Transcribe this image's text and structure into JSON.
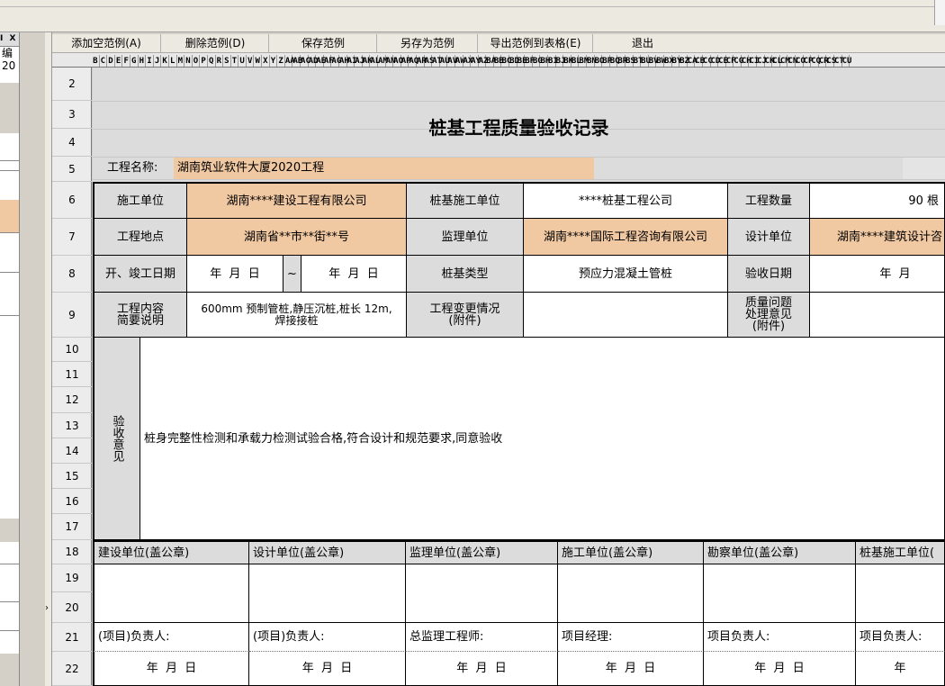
{
  "left_pane": {
    "header": "I X",
    "label": "编\n20"
  },
  "toolbar": {
    "add": "添加空范例(A)",
    "delete": "删除范例(D)",
    "save": "保存范例",
    "save_as": "另存为范例",
    "export": "导出范例到表格(E)",
    "exit": "退出"
  },
  "columns": [
    "B",
    "C",
    "D",
    "E",
    "F",
    "G",
    "H",
    "I",
    "J",
    "K",
    "L",
    "M",
    "N",
    "O",
    "P",
    "Q",
    "R",
    "S",
    "T",
    "U",
    "V",
    "W",
    "X",
    "Y",
    "Z",
    "AA",
    "AB",
    "AC",
    "AD",
    "AE",
    "AF",
    "AG",
    "AH",
    "AI",
    "AJ",
    "AK",
    "AL",
    "AM",
    "AN",
    "AO",
    "AP",
    "AQ",
    "AR",
    "AS",
    "AT",
    "AU",
    "AV",
    "AW",
    "AX",
    "AY",
    "AZ",
    "BA",
    "BB",
    "BC",
    "BD",
    "BE",
    "BF",
    "BG",
    "BH",
    "BI",
    "BJ",
    "BK",
    "BL",
    "BM",
    "BN",
    "BO",
    "BP",
    "BQ",
    "BR",
    "BS",
    "BT",
    "BU",
    "BV",
    "BW",
    "BX",
    "BY",
    "BZ",
    "CA",
    "CB",
    "CC",
    "CD",
    "CE",
    "CF",
    "CG",
    "CH",
    "CI",
    "CJ",
    "CK",
    "CL",
    "CM",
    "CN",
    "CO",
    "CP",
    "CQ",
    "CR",
    "CS",
    "CT",
    "CU"
  ],
  "row_numbers": [
    "2",
    "3",
    "4",
    "5",
    "6",
    "7",
    "8",
    "9",
    "10",
    "11",
    "12",
    "13",
    "14",
    "15",
    "16",
    "17",
    "18",
    "19",
    "20",
    "21",
    "22"
  ],
  "form": {
    "title": "桩基工程质量验收记录",
    "project_name_label": "工程名称:",
    "project_name": "湖南筑业软件大厦2020工程",
    "construction_unit_label": "施工单位",
    "construction_unit": "湖南****建设工程有限公司",
    "pile_unit_label": "桩基施工单位",
    "pile_unit": "****桩基工程公司",
    "quantity_label": "工程数量",
    "quantity": "90 根",
    "location_label": "工程地点",
    "location": "湖南省**市**街**号",
    "supervision_label": "监理单位",
    "supervision": "湖南****国际工程咨询有限公司",
    "design_label": "设计单位",
    "design": "湖南****建筑设计咨",
    "dates_label": "开、竣工日期",
    "start_date": "年  月  日",
    "tilde": "~",
    "end_date": "年  月  日",
    "pile_type_label": "桩基类型",
    "pile_type": "预应力混凝土管桩",
    "accept_date_label": "验收日期",
    "accept_date": "年  月",
    "content_label": "工程内容\n简要说明",
    "content": "600mm 预制管桩,静压沉桩,桩长 12m,\n焊接接桩",
    "change_label": "工程变更情况\n(附件)",
    "quality_label": "质量问题\n处理意见\n(附件)",
    "opinion_label": "验收意见",
    "opinion": "桩身完整性检测和承载力检测试验合格,符合设计和规范要求,同意验收",
    "sign": [
      {
        "unit": "建设单位(盖公章)",
        "person": "(项目)负责人:",
        "date": "年  月  日"
      },
      {
        "unit": "设计单位(盖公章)",
        "person": "(项目)负责人:",
        "date": "年  月  日"
      },
      {
        "unit": "监理单位(盖公章)",
        "person": "总监理工程师:",
        "date": "年  月  日"
      },
      {
        "unit": "施工单位(盖公章)",
        "person": "项目经理:",
        "date": "年  月  日"
      },
      {
        "unit": "勘察单位(盖公章)",
        "person": "项目负责人:",
        "date": "年  月  日"
      },
      {
        "unit": "桩基施工单位(",
        "person": "项目负责人:",
        "date": "年"
      }
    ]
  }
}
